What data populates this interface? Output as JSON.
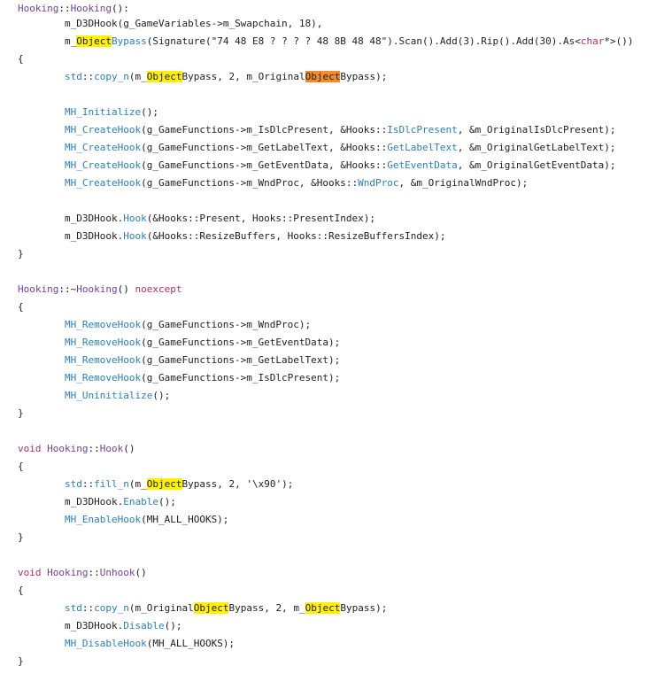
{
  "lines": [
    [
      {
        "t": "Hooking",
        "c": "cls"
      },
      {
        "t": "::"
      },
      {
        "t": "Hooking",
        "c": "cls"
      },
      {
        "t": "():"
      }
    ],
    [
      {
        "t": "m_D3DHook"
      },
      {
        "t": "("
      },
      {
        "t": "g_GameVariables->m_Swapchain, "
      },
      {
        "t": "18",
        "c": "num"
      },
      {
        "t": "),"
      }
    ],
    [
      {
        "t": "m_"
      },
      {
        "t": "Object",
        "hl": "yellow"
      },
      {
        "t": "Bypass",
        "c": "fn"
      },
      {
        "t": "(Signature(\"74 48 E8 ? ? ? ? 48 8B 48 48\").Scan().Add("
      },
      {
        "t": "3",
        "c": "num"
      },
      {
        "t": ").Rip().Add("
      },
      {
        "t": "30",
        "c": "num"
      },
      {
        "t": ").As<"
      },
      {
        "t": "char",
        "c": "ty"
      },
      {
        "t": "*>())"
      }
    ],
    [
      {
        "t": "{"
      }
    ],
    [
      {
        "t": "std",
        "c": "fn"
      },
      {
        "t": "::"
      },
      {
        "t": "copy_n",
        "c": "fn"
      },
      {
        "t": "(m_"
      },
      {
        "t": "Object",
        "hl": "yellow"
      },
      {
        "t": "Bypass, "
      },
      {
        "t": "2",
        "c": "num"
      },
      {
        "t": ", m_Original"
      },
      {
        "t": "Object",
        "hl": "orange"
      },
      {
        "t": "Bypass);"
      }
    ],
    [],
    [
      {
        "t": "MH_Initialize",
        "c": "fn"
      },
      {
        "t": "();"
      }
    ],
    [
      {
        "t": "MH_CreateHook",
        "c": "fn"
      },
      {
        "t": "(g_GameFunctions->m_IsDlcPresent, &Hooks::"
      },
      {
        "t": "IsDlcPresent",
        "c": "fn"
      },
      {
        "t": ", &m_OriginalIsDlcPresent);"
      }
    ],
    [
      {
        "t": "MH_CreateHook",
        "c": "fn"
      },
      {
        "t": "(g_GameFunctions->m_GetLabelText, &Hooks::"
      },
      {
        "t": "GetLabelText",
        "c": "fn"
      },
      {
        "t": ", &m_OriginalGetLabelText);"
      }
    ],
    [
      {
        "t": "MH_CreateHook",
        "c": "fn"
      },
      {
        "t": "(g_GameFunctions->m_GetEventData, &Hooks::"
      },
      {
        "t": "GetEventData",
        "c": "fn"
      },
      {
        "t": ", &m_OriginalGetEventData);"
      }
    ],
    [
      {
        "t": "MH_CreateHook",
        "c": "fn"
      },
      {
        "t": "(g_GameFunctions->m_WndProc, &Hooks::"
      },
      {
        "t": "WndProc",
        "c": "fn"
      },
      {
        "t": ", &m_OriginalWndProc);"
      }
    ],
    [],
    [
      {
        "t": "m_D3DHook."
      },
      {
        "t": "Hook",
        "c": "fn"
      },
      {
        "t": "(&Hooks::Present, Hooks::PresentIndex);"
      }
    ],
    [
      {
        "t": "m_D3DHook."
      },
      {
        "t": "Hook",
        "c": "fn"
      },
      {
        "t": "(&Hooks::ResizeBuffers, Hooks::ResizeBuffersIndex);"
      }
    ],
    [
      {
        "t": "}"
      }
    ],
    [],
    [
      {
        "t": "Hooking",
        "c": "cls"
      },
      {
        "t": "::~"
      },
      {
        "t": "Hooking",
        "c": "cls"
      },
      {
        "t": "() "
      },
      {
        "t": "noexcept",
        "c": "kw"
      }
    ],
    [
      {
        "t": "{"
      }
    ],
    [
      {
        "t": "MH_RemoveHook",
        "c": "fn"
      },
      {
        "t": "(g_GameFunctions->m_WndProc);"
      }
    ],
    [
      {
        "t": "MH_RemoveHook",
        "c": "fn"
      },
      {
        "t": "(g_GameFunctions->m_GetEventData);"
      }
    ],
    [
      {
        "t": "MH_RemoveHook",
        "c": "fn"
      },
      {
        "t": "(g_GameFunctions->m_GetLabelText);"
      }
    ],
    [
      {
        "t": "MH_RemoveHook",
        "c": "fn"
      },
      {
        "t": "(g_GameFunctions->m_IsDlcPresent);"
      }
    ],
    [
      {
        "t": "MH_Uninitialize",
        "c": "fn"
      },
      {
        "t": "();"
      }
    ],
    [
      {
        "t": "}"
      }
    ],
    [],
    [
      {
        "t": "void",
        "c": "kw"
      },
      {
        "t": " "
      },
      {
        "t": "Hooking",
        "c": "cls"
      },
      {
        "t": "::"
      },
      {
        "t": "Hook",
        "c": "cls"
      },
      {
        "t": "()"
      }
    ],
    [
      {
        "t": "{"
      }
    ],
    [
      {
        "t": "std",
        "c": "fn"
      },
      {
        "t": "::"
      },
      {
        "t": "fill_n",
        "c": "fn"
      },
      {
        "t": "(m_"
      },
      {
        "t": "Object",
        "hl": "yellow"
      },
      {
        "t": "Bypass, "
      },
      {
        "t": "2",
        "c": "num"
      },
      {
        "t": ", '\\x90');"
      }
    ],
    [
      {
        "t": "m_D3DHook."
      },
      {
        "t": "Enable",
        "c": "fn"
      },
      {
        "t": "();"
      }
    ],
    [
      {
        "t": "MH_EnableHook",
        "c": "fn"
      },
      {
        "t": "(MH_ALL_HOOKS);"
      }
    ],
    [
      {
        "t": "}"
      }
    ],
    [],
    [
      {
        "t": "void",
        "c": "kw"
      },
      {
        "t": " "
      },
      {
        "t": "Hooking",
        "c": "cls"
      },
      {
        "t": "::"
      },
      {
        "t": "Unhook",
        "c": "cls"
      },
      {
        "t": "()"
      }
    ],
    [
      {
        "t": "{"
      }
    ],
    [
      {
        "t": "std",
        "c": "fn"
      },
      {
        "t": "::"
      },
      {
        "t": "copy_n",
        "c": "fn"
      },
      {
        "t": "(m_Original"
      },
      {
        "t": "Object",
        "hl": "yellow"
      },
      {
        "t": "Bypass, "
      },
      {
        "t": "2",
        "c": "num"
      },
      {
        "t": ", m_"
      },
      {
        "t": "Object",
        "hl": "yellow"
      },
      {
        "t": "Bypass);"
      }
    ],
    [
      {
        "t": "m_D3DHook."
      },
      {
        "t": "Disable",
        "c": "fn"
      },
      {
        "t": "();"
      }
    ],
    [
      {
        "t": "MH_DisableHook",
        "c": "fn"
      },
      {
        "t": "(MH_ALL_HOOKS);"
      }
    ],
    [
      {
        "t": "}"
      }
    ]
  ]
}
